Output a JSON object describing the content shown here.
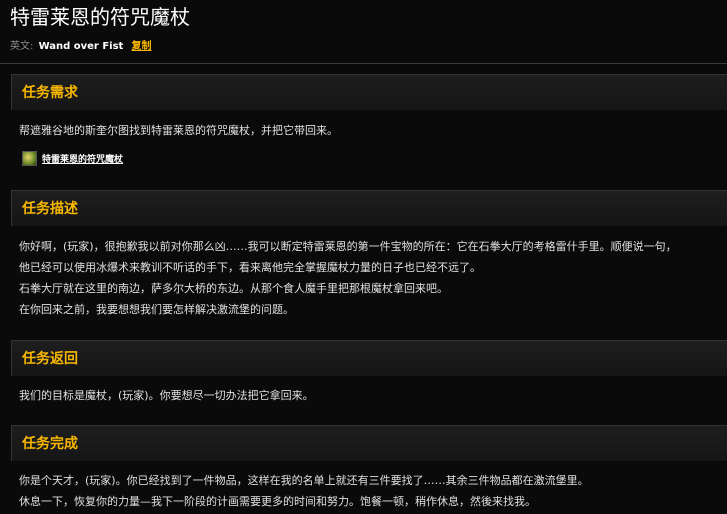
{
  "title": "特雷莱恩的符咒魔杖",
  "english": {
    "label": "英文:",
    "value": "Wand over Fist",
    "copy_label": "复制"
  },
  "sections": {
    "requirements": {
      "heading": "任务需求",
      "lines": [
        "帮遮雅谷地的斯奎尔图找到特雷莱恩的符咒魔杖，并把它带回来。"
      ],
      "item": {
        "name": "特雷莱恩的符咒魔杖",
        "icon": "wand-item-icon"
      }
    },
    "description": {
      "heading": "任务描述",
      "lines": [
        "你好啊，(玩家)，很抱歉我以前对你那么凶……我可以断定特雷莱恩的第一件宝物的所在：它在石拳大厅的考格雷什手里。顺便说一句，",
        "他已经可以使用冰爆术来教训不听话的手下，看来离他完全掌握魔杖力量的日子也已经不远了。",
        "石拳大厅就在这里的南边，萨多尔大桥的东边。从那个食人魔手里把那根魔杖拿回来吧。",
        "在你回来之前，我要想想我们要怎样解决激流堡的问题。"
      ]
    },
    "return": {
      "heading": "任务返回",
      "lines": [
        "我们的目标是魔杖，(玩家)。你要想尽一切办法把它拿回来。"
      ]
    },
    "complete": {
      "heading": "任务完成",
      "lines": [
        "你是个天才，(玩家)。你已经找到了一件物品，这样在我的名单上就还有三件要找了……其余三件物品都在激流堡里。",
        "休息一下，恢复你的力量—我下一阶段的计画需要更多的时间和努力。饱餐一顿，稍作休息，然後来找我。"
      ]
    }
  },
  "colors": {
    "background": "#0a0a0a",
    "heading": "#f8b700",
    "text": "#e0e0e0",
    "copy_link": "#f8b700"
  }
}
